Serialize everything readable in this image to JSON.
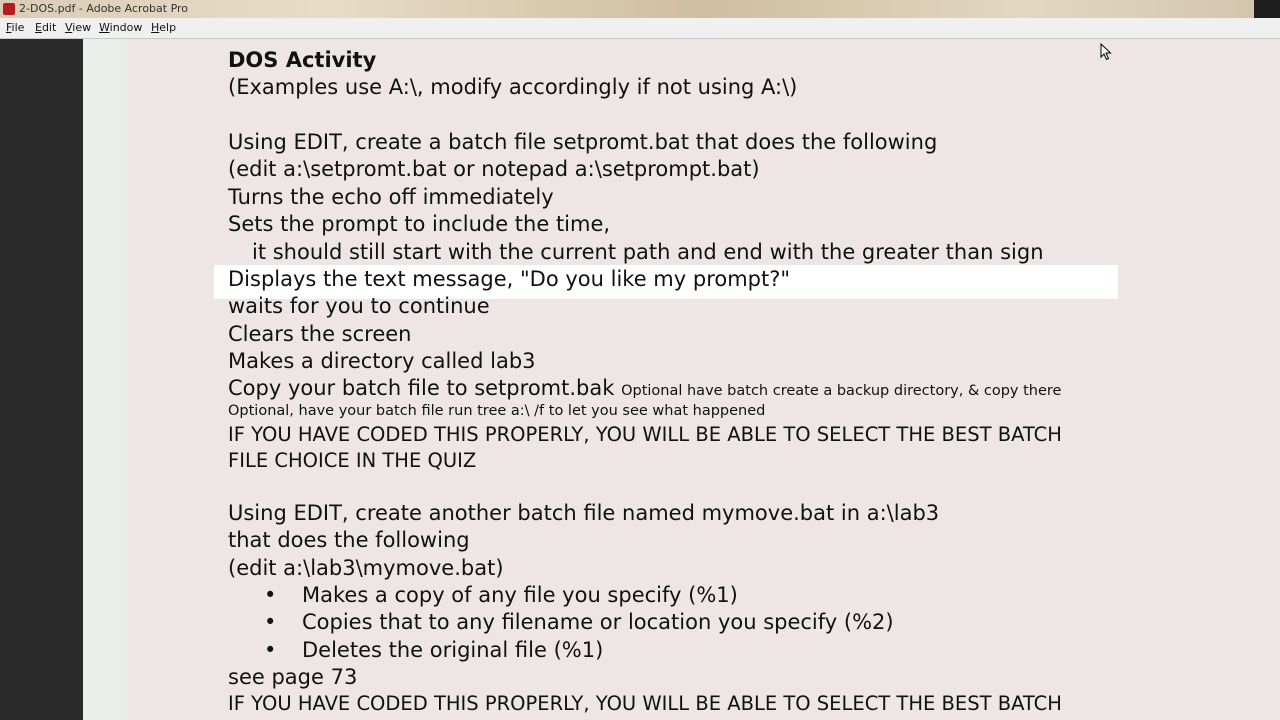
{
  "window": {
    "title": "2-DOS.pdf - Adobe Acrobat Pro"
  },
  "menu": {
    "items": [
      "File",
      "Edit",
      "View",
      "Window",
      "Help"
    ]
  },
  "document": {
    "heading": "DOS Activity",
    "lines": [
      "(Examples use A:\\, modify accordingly if not using A:\\)",
      "Using EDIT, create a batch file setpromt.bat that does the following",
      "(edit a:\\setpromt.bat or notepad a:\\setprompt.bat)",
      "Turns the echo off immediately",
      "Sets the prompt to include the time,",
      "it should still start with the current path and end with the greater than sign",
      "Displays the text message, \"Do you like my prompt?\"",
      "waits for you to continue",
      "Clears the screen",
      "Makes a directory called lab3",
      "Copy your batch file to setpromt.bak",
      "Optional have batch create a backup directory, & copy there",
      "Optional, have your batch file run tree a:\\ /f to let you see what happened",
      "IF YOU HAVE CODED THIS PROPERLY, YOU WILL BE ABLE TO SELECT THE BEST BATCH",
      "FILE CHOICE IN THE QUIZ",
      "Using EDIT, create another batch file named mymove.bat in a:\\lab3",
      "that does the following",
      "(edit a:\\lab3\\mymove.bat)",
      "see page 73",
      "IF YOU HAVE CODED THIS PROPERLY, YOU WILL BE ABLE TO SELECT THE BEST BATCH"
    ],
    "bullets": [
      "Makes a copy of any file you specify (%1)",
      "Copies that to any filename or location you specify (%2)",
      "Deletes the original file (%1)"
    ],
    "bullet_glyph": "•"
  },
  "colors": {
    "page_background": "#eee6e5",
    "highlight": "#ffffff",
    "app_icon": "#b91c1c"
  },
  "icons": {
    "app": "acrobat-icon",
    "cursor": "mouse-pointer-icon"
  }
}
